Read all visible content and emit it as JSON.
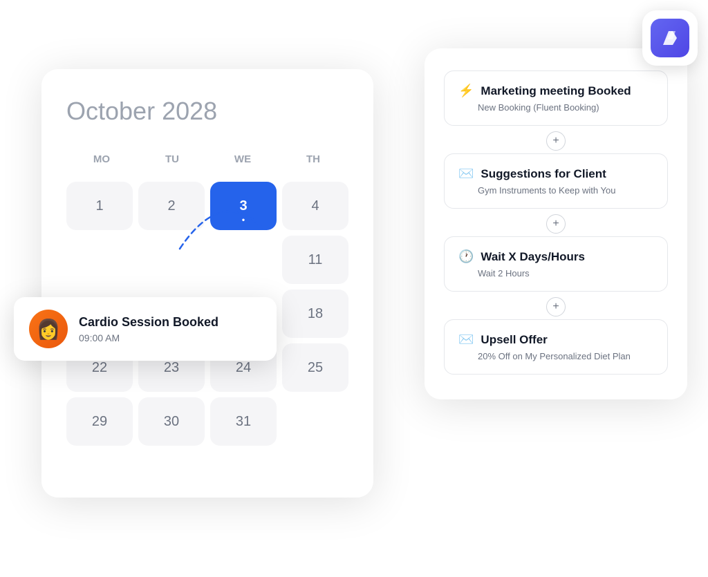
{
  "calendar": {
    "month": "October",
    "year": "2028",
    "days_header": [
      "MO",
      "TU",
      "WE",
      "TH"
    ],
    "rows": [
      [
        {
          "label": "1",
          "state": "normal"
        },
        {
          "label": "2",
          "state": "normal"
        },
        {
          "label": "3",
          "state": "active"
        },
        {
          "label": "4",
          "state": "normal"
        }
      ],
      [
        {
          "label": "",
          "state": "empty"
        },
        {
          "label": "",
          "state": "empty"
        },
        {
          "label": "",
          "state": "empty"
        },
        {
          "label": "11",
          "state": "normal"
        }
      ],
      [
        {
          "label": "",
          "state": "empty"
        },
        {
          "label": "",
          "state": "empty"
        },
        {
          "label": "",
          "state": "empty"
        },
        {
          "label": "18",
          "state": "normal"
        }
      ],
      [
        {
          "label": "22",
          "state": "normal"
        },
        {
          "label": "23",
          "state": "normal"
        },
        {
          "label": "24",
          "state": "normal"
        },
        {
          "label": "25",
          "state": "normal"
        }
      ],
      [
        {
          "label": "29",
          "state": "normal"
        },
        {
          "label": "30",
          "state": "normal"
        },
        {
          "label": "31",
          "state": "normal"
        },
        {
          "label": "",
          "state": "empty"
        }
      ]
    ]
  },
  "booking": {
    "title": "Cardio Session Booked",
    "time": "09:00 AM",
    "avatar_emoji": "👩"
  },
  "workflow": {
    "steps": [
      {
        "icon": "⚡",
        "title": "Marketing meeting Booked",
        "subtitle": "New Booking (Fluent Booking)"
      },
      {
        "icon": "✉️",
        "title": "Suggestions for Client",
        "subtitle": "Gym Instruments to Keep with You"
      },
      {
        "icon": "🕐",
        "title": "Wait X Days/Hours",
        "subtitle": "Wait 2 Hours"
      },
      {
        "icon": "✉️",
        "title": "Upsell Offer",
        "subtitle": "20% Off on My Personalized Diet Plan"
      }
    ],
    "connector_label": "+"
  },
  "logo": {
    "aria": "Fluent Booking Logo"
  }
}
